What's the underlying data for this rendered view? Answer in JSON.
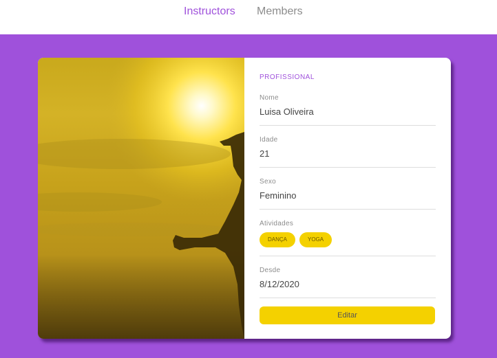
{
  "nav": {
    "instructors_label": "Instructors",
    "members_label": "Members",
    "active_color": "#9f51db",
    "inactive_color": "#8c8c8c"
  },
  "page": {
    "background_color": "#9f51db"
  },
  "card": {
    "photo": {
      "icon": "runner-silhouette-sunset-photo"
    },
    "section_title": "PROFISSIONAL",
    "fields": {
      "nome": {
        "label": "Nome",
        "value": "Luisa Oliveira"
      },
      "idade": {
        "label": "Idade",
        "value": "21"
      },
      "sexo": {
        "label": "Sexo",
        "value": "Feminino"
      },
      "atividades": {
        "label": "Atividades",
        "tags": [
          "DANÇA",
          "YOGA"
        ]
      },
      "desde": {
        "label": "Desde",
        "value": "8/12/2020"
      }
    },
    "edit_button_label": "Editar",
    "accent_color": "#f4d100"
  }
}
